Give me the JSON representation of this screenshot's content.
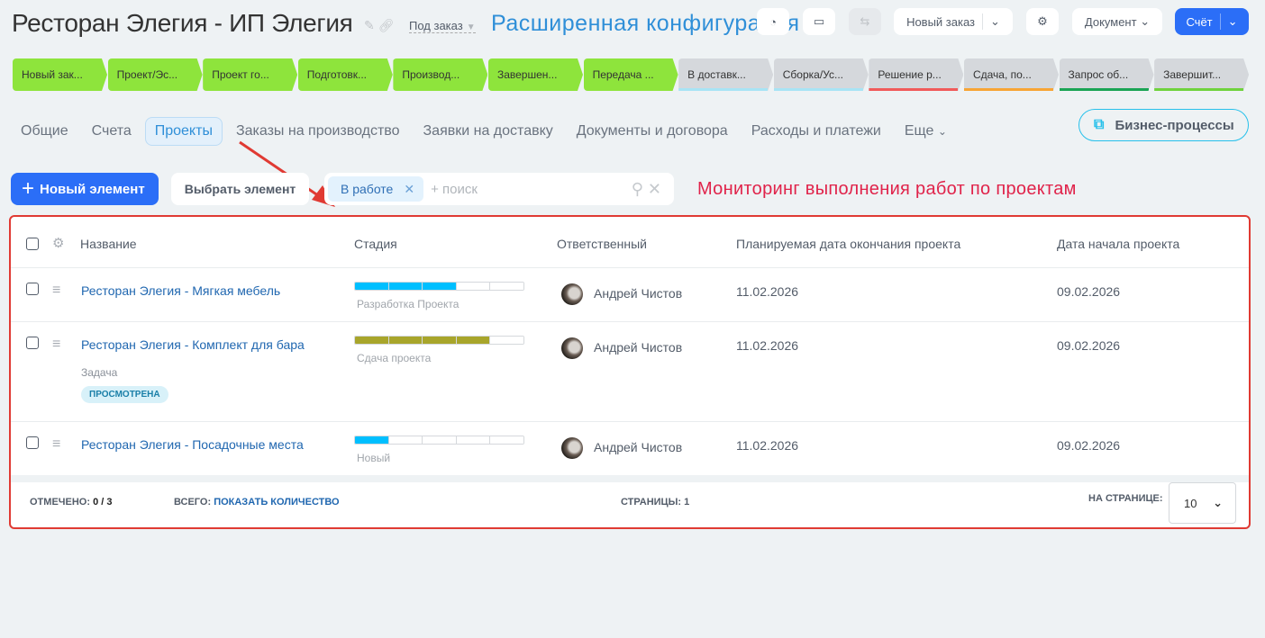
{
  "header": {
    "title": "Ресторан Элегия - ИП Элегия",
    "mode": "Под заказ",
    "annotation": "Расширенная конфигурация",
    "new_order": "Новый заказ",
    "document": "Документ",
    "invoice": "Счёт"
  },
  "stages": [
    {
      "label": "Новый зак...",
      "color": "#8ee43c",
      "bar": ""
    },
    {
      "label": "Проект/Эс...",
      "color": "#8ee43c",
      "bar": ""
    },
    {
      "label": "Проект го...",
      "color": "#8ee43c",
      "bar": ""
    },
    {
      "label": "Подготовк...",
      "color": "#8ee43c",
      "bar": ""
    },
    {
      "label": "Производ...",
      "color": "#8ee43c",
      "bar": ""
    },
    {
      "label": "Завершен...",
      "color": "#8ee43c",
      "bar": ""
    },
    {
      "label": "Передача ...",
      "color": "#8ee43c",
      "bar": ""
    },
    {
      "label": "В доставк...",
      "color": "#d5d8dc",
      "bar": "#a8e4f5"
    },
    {
      "label": "Сборка/Ус...",
      "color": "#d5d8dc",
      "bar": "#a8e4f5"
    },
    {
      "label": "Решение р...",
      "color": "#d5d8dc",
      "bar": "#f05a5a"
    },
    {
      "label": "Сдача, по...",
      "color": "#d5d8dc",
      "bar": "#f7a535"
    },
    {
      "label": "Запрос об...",
      "color": "#d5d8dc",
      "bar": "#1aa454"
    },
    {
      "label": "Завершит...",
      "color": "#d5d8dc",
      "bar": "#6fd23d"
    }
  ],
  "tabs": [
    "Общие",
    "Счета",
    "Проекты",
    "Заказы на производство",
    "Заявки на доставку",
    "Документы и договора",
    "Расходы и платежи",
    "Еще"
  ],
  "business_processes": "Бизнес-процессы",
  "toolbar": {
    "new_element": "Новый элемент",
    "select_element": "Выбрать элемент",
    "filter_chip": "В работе",
    "search_placeholder": "+ поиск",
    "annotation": "Мониторинг выполнения работ по проектам"
  },
  "table": {
    "columns": [
      "Название",
      "Стадия",
      "Ответственный",
      "Планируемая дата окончания проекта",
      "Дата начала проекта"
    ],
    "rows": [
      {
        "name": "Ресторан Элегия - Мягкая мебель",
        "stage": "Разработка Проекта",
        "progress_segments": 3,
        "total_segments": 5,
        "stage_color": "#00bfff",
        "owner": "Андрей Чистов",
        "end": "11.02.2026",
        "start": "09.02.2026"
      },
      {
        "name": "Ресторан Элегия - Комплект для бара",
        "stage": "Сдача проекта",
        "progress_segments": 4,
        "total_segments": 5,
        "stage_color": "#a8a52b",
        "owner": "Андрей Чистов",
        "end": "11.02.2026",
        "start": "09.02.2026",
        "sub": "Задача",
        "badge": "ПРОСМОТРЕНА"
      },
      {
        "name": "Ресторан Элегия - Посадочные места",
        "stage": "Новый",
        "progress_segments": 1,
        "total_segments": 5,
        "stage_color": "#00bfff",
        "owner": "Андрей Чистов",
        "end": "11.02.2026",
        "start": "09.02.2026"
      }
    ]
  },
  "footer": {
    "checked_label": "ОТМЕЧЕНО:",
    "checked_value": "0 / 3",
    "total_label": "ВСЕГО:",
    "total_link": "ПОКАЗАТЬ КОЛИЧЕСТВО",
    "pages_label": "СТРАНИЦЫ:",
    "pages_value": "1",
    "per_page_label": "НА СТРАНИЦЕ:",
    "per_page_value": "10"
  }
}
